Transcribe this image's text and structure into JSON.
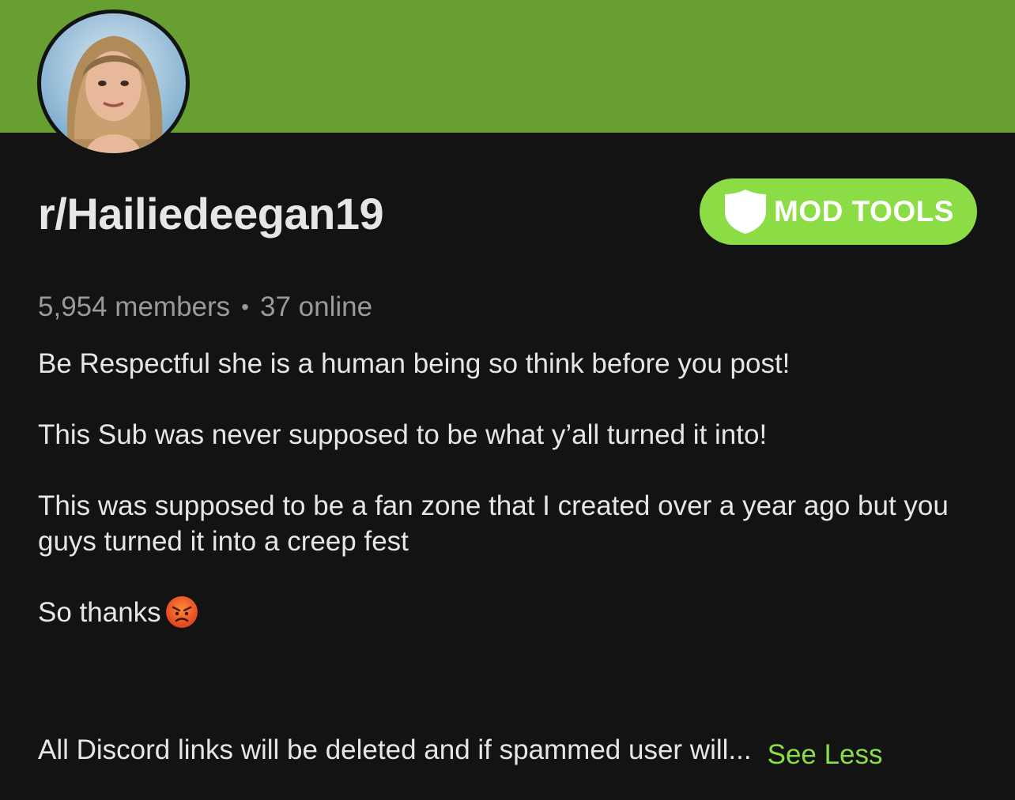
{
  "banner": {
    "color": "#67a031"
  },
  "community": {
    "name": "r/Hailiedeegan19",
    "members": "5,954 members",
    "separator": "•",
    "online": "37 online"
  },
  "mod_tools": {
    "label": "MOD TOOLS",
    "icon": "shield-icon",
    "color": "#8bdc45"
  },
  "description": {
    "line1": "Be Respectful she is a human being so think before you post!",
    "line2": "This Sub was never supposed to be what y’all turned it into!",
    "line3": "This was supposed to be a fan zone that I created over a year ago but you guys turned it into a creep fest",
    "line4": "So thanks",
    "emoji": "angry-face-emoji",
    "line5": "All Discord links will be deleted and if spammed user will...",
    "see_less": "See Less"
  }
}
